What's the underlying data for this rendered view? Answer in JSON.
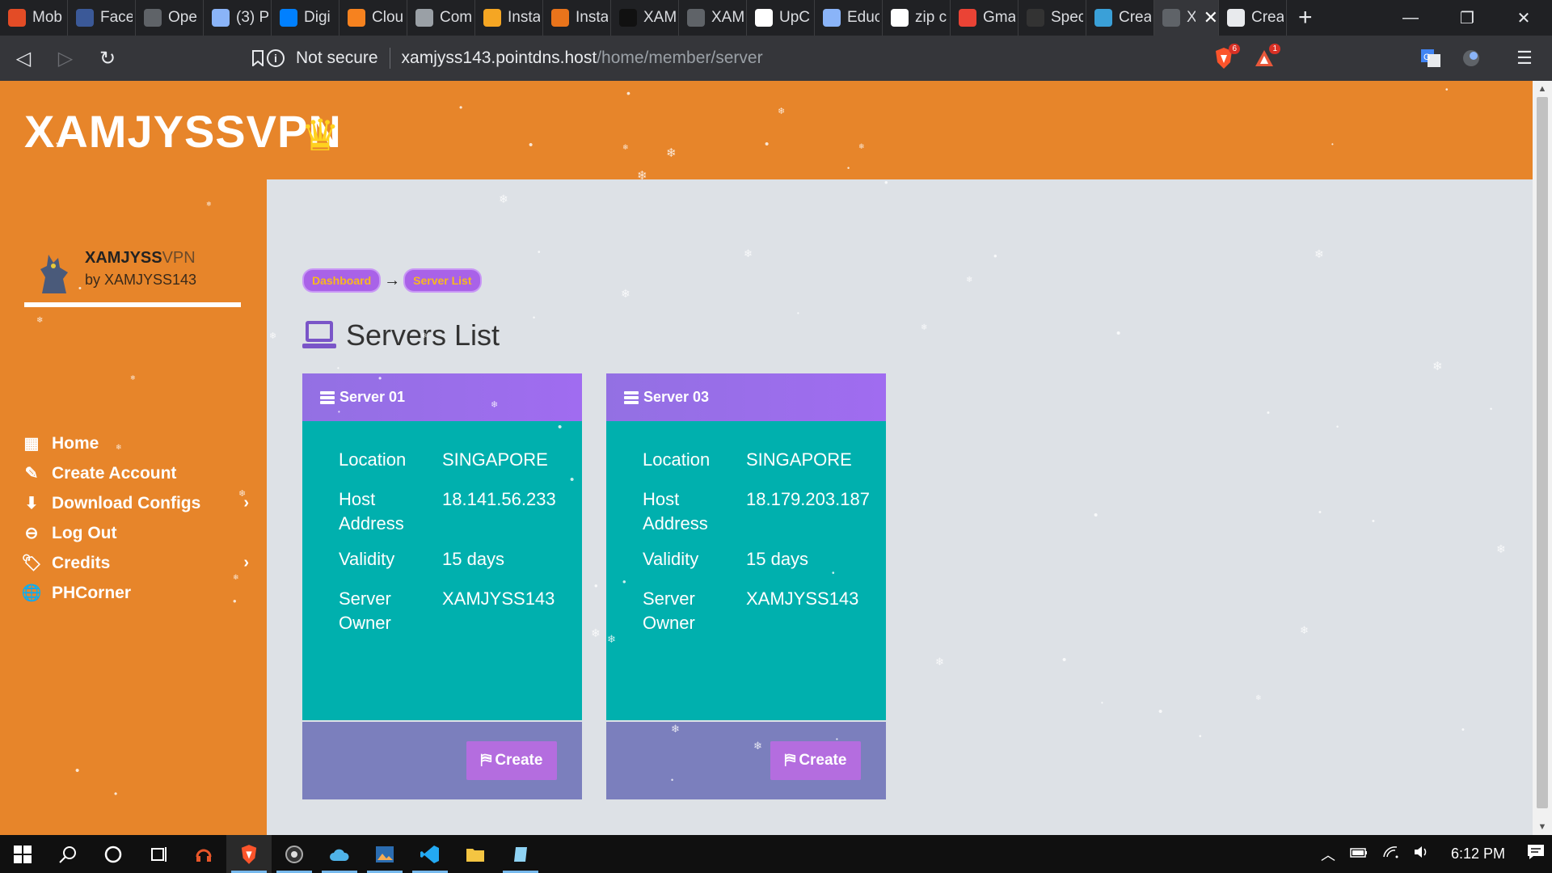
{
  "browser": {
    "tabs": [
      {
        "label": "Mob",
        "icon": "generic-favicon",
        "color": "#e34c26"
      },
      {
        "label": "Face",
        "icon": "facebook-icon",
        "color": "#3b5998"
      },
      {
        "label": "Ope",
        "icon": "globe-icon",
        "color": "#5f6368"
      },
      {
        "label": "(3) P",
        "icon": "cube-icon",
        "color": "#8ab4f8"
      },
      {
        "label": "Digi",
        "icon": "digitalocean-icon",
        "color": "#0080ff"
      },
      {
        "label": "Clou",
        "icon": "cloud-icon",
        "color": "#f6821f"
      },
      {
        "label": "Com",
        "icon": "chip-icon",
        "color": "#9aa0a6"
      },
      {
        "label": "Insta",
        "icon": "box-icon",
        "color": "#f5a623"
      },
      {
        "label": "Insta",
        "icon": "box-icon",
        "color": "#e9741b"
      },
      {
        "label": "XAM",
        "icon": "dark-icon",
        "color": "#111111"
      },
      {
        "label": "XAM",
        "icon": "globe-icon",
        "color": "#5f6368"
      },
      {
        "label": "UpC",
        "icon": "upc-icon",
        "color": "#ffffff"
      },
      {
        "label": "Educ",
        "icon": "triangle-icon",
        "color": "#8ab4f8"
      },
      {
        "label": "zip c",
        "icon": "google-icon",
        "color": "#ffffff"
      },
      {
        "label": "Gma",
        "icon": "gmail-icon",
        "color": "#ea4335"
      },
      {
        "label": "Spec",
        "icon": "speed-icon",
        "color": "#333333"
      },
      {
        "label": "Crea",
        "icon": "edge-icon",
        "color": "#3aa0d8"
      },
      {
        "label": "X",
        "icon": "globe-icon",
        "color": "#5f6368",
        "active": true
      },
      {
        "label": "Crea",
        "icon": "globe-icon",
        "color": "#e8eaed"
      }
    ],
    "new_tab": "+",
    "window": {
      "minimize": "—",
      "restore": "❐",
      "close": "✕"
    },
    "nav": {
      "back": "◁",
      "forward": "▷",
      "reload": "↻",
      "bookmark": "🔖"
    },
    "url": {
      "security_label": "Not secure",
      "host": "xamjyss143.pointdns.host",
      "path": "/home/member/server"
    },
    "extensions": [
      {
        "name": "brave-shields-icon",
        "badge": "6"
      },
      {
        "name": "brave-rewards-icon",
        "badge": "1"
      },
      {
        "name": "translate-icon"
      },
      {
        "name": "extension-icon"
      }
    ],
    "menu": "☰"
  },
  "site": {
    "brand": "XAMJYSSVPN",
    "crown": "♛",
    "profile": {
      "name_bold": "XAMJYSS",
      "name_rest": "VPN",
      "by": "by XAMJYSS143"
    },
    "menu": [
      {
        "label": "Home",
        "icon": "▦",
        "chevron": false
      },
      {
        "label": "Create Account",
        "icon": "✎",
        "chevron": false
      },
      {
        "label": "Download Configs",
        "icon": "⬇",
        "chevron": true
      },
      {
        "label": "Log Out",
        "icon": "⊖",
        "chevron": false
      },
      {
        "label": "Credits",
        "icon": "🏷",
        "chevron": true
      },
      {
        "label": "PHCorner",
        "icon": "🌐",
        "chevron": false
      }
    ],
    "breadcrumb": {
      "first": "Dashboard",
      "second": "Server List",
      "arrow": "→"
    },
    "page_title": "Servers List",
    "servers": [
      {
        "title": "Server 01",
        "location_label": "Location",
        "location": "SINGAPORE",
        "host_label": "Host Address",
        "host": "18.141.56.233",
        "validity_label": "Validity",
        "validity": "15 days",
        "owner_label": "Server Owner",
        "owner": "XAMJYSS143",
        "button": "Create"
      },
      {
        "title": "Server 03",
        "location_label": "Location",
        "location": "SINGAPORE",
        "host_label": "Host Address",
        "host": "18.179.203.187",
        "validity_label": "Validity",
        "validity": "15 days",
        "owner_label": "Server Owner",
        "owner": "XAMJYSS143",
        "button": "Create"
      }
    ],
    "colors": {
      "header": "#e7852a",
      "card_head": "#9370e3",
      "card_body": "#00b0ae",
      "card_foot": "#7b7fbd",
      "button": "#b46ddf"
    }
  },
  "taskbar": {
    "clock": "6:12 PM",
    "apps": [
      "windows-start-icon",
      "search-icon",
      "cortana-icon",
      "task-view-icon",
      "headset-icon",
      "brave-icon",
      "obs-icon",
      "cloud-app-icon",
      "photos-icon",
      "vscode-icon",
      "file-explorer-icon",
      "notepad-icon"
    ]
  }
}
